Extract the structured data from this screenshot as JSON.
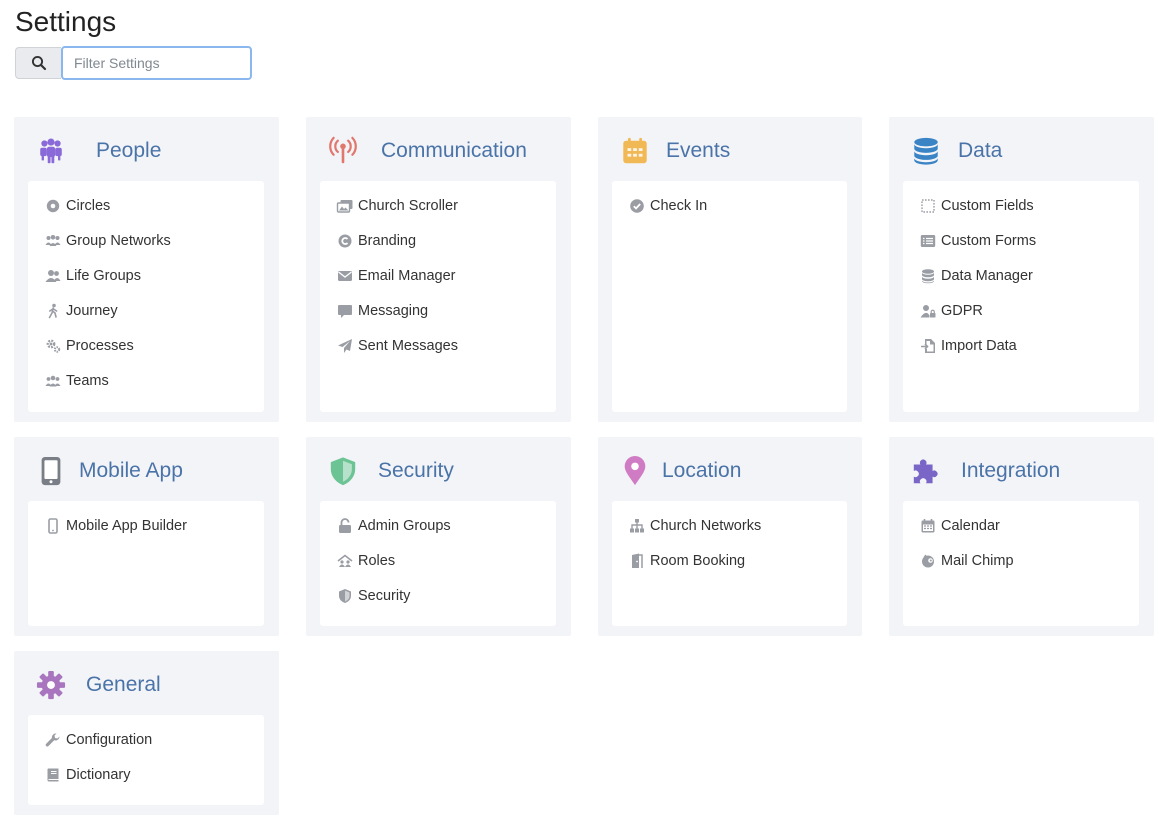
{
  "page": {
    "title": "Settings"
  },
  "search": {
    "placeholder": "Filter Settings",
    "value": ""
  },
  "cards": [
    {
      "title": "People",
      "icon": "people-icon",
      "color": "#8a6ad8",
      "items": [
        {
          "label": "Circles",
          "icon": "circle-icon"
        },
        {
          "label": "Group Networks",
          "icon": "group-networks-icon"
        },
        {
          "label": "Life Groups",
          "icon": "users-icon"
        },
        {
          "label": "Journey",
          "icon": "walking-icon"
        },
        {
          "label": "Processes",
          "icon": "cogs-icon"
        },
        {
          "label": "Teams",
          "icon": "teams-icon"
        }
      ]
    },
    {
      "title": "Communication",
      "icon": "broadcast-tower-icon",
      "color": "#e0786e",
      "items": [
        {
          "label": "Church Scroller",
          "icon": "images-icon"
        },
        {
          "label": "Branding",
          "icon": "copyright-icon"
        },
        {
          "label": "Email Manager",
          "icon": "envelope-icon"
        },
        {
          "label": "Messaging",
          "icon": "comment-icon"
        },
        {
          "label": "Sent Messages",
          "icon": "paper-plane-icon"
        }
      ]
    },
    {
      "title": "Events",
      "icon": "calendar-icon",
      "color": "#f1b956",
      "items": [
        {
          "label": "Check In",
          "icon": "check-circle-icon"
        }
      ]
    },
    {
      "title": "Data",
      "icon": "database-icon",
      "color": "#3a84c6",
      "items": [
        {
          "label": "Custom Fields",
          "icon": "dotted-square-icon"
        },
        {
          "label": "Custom Forms",
          "icon": "list-alt-icon"
        },
        {
          "label": "Data Manager",
          "icon": "database-icon"
        },
        {
          "label": "GDPR",
          "icon": "user-lock-icon"
        },
        {
          "label": "Import Data",
          "icon": "file-import-icon"
        }
      ]
    },
    {
      "title": "Mobile App",
      "icon": "mobile-icon",
      "color": "#7a7e86",
      "items": [
        {
          "label": "Mobile App Builder",
          "icon": "mobile-icon"
        }
      ]
    },
    {
      "title": "Security",
      "icon": "shield-icon",
      "color": "#6cc394",
      "items": [
        {
          "label": "Admin Groups",
          "icon": "unlock-icon"
        },
        {
          "label": "Roles",
          "icon": "roles-icon"
        },
        {
          "label": "Security",
          "icon": "shield-icon"
        }
      ]
    },
    {
      "title": "Location",
      "icon": "map-marker-icon",
      "color": "#d07cc4",
      "items": [
        {
          "label": "Church Networks",
          "icon": "sitemap-icon"
        },
        {
          "label": "Room Booking",
          "icon": "door-icon"
        }
      ]
    },
    {
      "title": "Integration",
      "icon": "puzzle-piece-icon",
      "color": "#7a66c6",
      "items": [
        {
          "label": "Calendar",
          "icon": "calendar-icon"
        },
        {
          "label": "Mail Chimp",
          "icon": "mailchimp-icon"
        }
      ]
    },
    {
      "title": "General",
      "icon": "cog-icon",
      "color": "#a875be",
      "items": [
        {
          "label": "Configuration",
          "icon": "wrench-icon"
        },
        {
          "label": "Dictionary",
          "icon": "book-icon"
        }
      ]
    }
  ]
}
